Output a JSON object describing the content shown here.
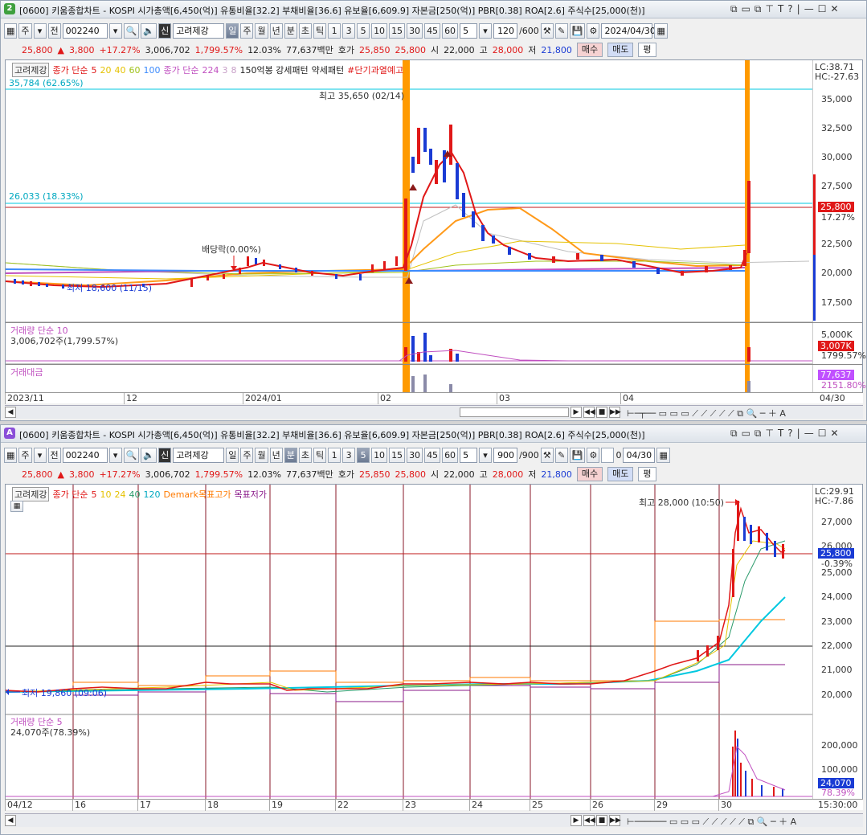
{
  "colors": {
    "up": "#e01818",
    "down": "#1a3bd4",
    "ma5": "#e01818",
    "ma20": "#ff9a1a",
    "ma60": "#9fc21a",
    "ma120": "#3d8bfd",
    "cyan": "#00c8e0",
    "magenta": "#c050c0",
    "orange": "#ff9a00"
  },
  "top": {
    "badge": "2",
    "title": "[0600] 키움종합차트 - KOSPI 시가총액[6,450(억)] 유통비율[32.2] 부채비율[36.6] 유보율[6,609.9] 자본금[250(억)] PBR[0.38] ROA[2.6] 주식수[25,000(천)]",
    "toolbar": {
      "mode1": "주",
      "mode2": "전",
      "code": "002240",
      "sin": "신",
      "adj": "고려제강",
      "periods": [
        "일",
        "주",
        "월",
        "년",
        "분",
        "초",
        "틱"
      ],
      "active_period": "일",
      "nums": [
        "1",
        "3",
        "5",
        "10",
        "15",
        "30",
        "45",
        "60"
      ],
      "sel": "5",
      "count": "120",
      "count_total": "/600",
      "date": "2024/04/30"
    },
    "quote": {
      "price": "25,800",
      "arrow": "▲",
      "chg": "3,800",
      "pct": "+17.27%",
      "vol": "3,006,702",
      "volpct": "1,799.57%",
      "turnover": "12.03%",
      "amount": "77,637백만",
      "hoga_label": "호가",
      "hoga1": "25,850",
      "hoga2": "25,800",
      "open_label": "시",
      "open": "22,000",
      "high_label": "고",
      "high": "28,000",
      "low_label": "저",
      "low": "21,800",
      "buy": "매수",
      "sell": "매도",
      "avg": "평"
    },
    "legend": {
      "adj": "고려제강",
      "ma_label": "종가 단순",
      "ma": [
        "5",
        "20",
        "40",
        "60",
        "100"
      ],
      "ma2_label": "종가 단순",
      "ma2": [
        "224",
        "3",
        "8"
      ],
      "pattern": "150억봉 강세패턴",
      "weak": "약세패턴",
      "warn": "#단기과열예고"
    },
    "annotations": {
      "line1": "35,784 (62.65%)",
      "line2": "26,033 (18.33%)",
      "high": "최고 35,650 (02/14)",
      "low": "최저 18,600 (11/15)",
      "div": "배당락(0.00%)"
    },
    "lc": "LC:38.71",
    "hc": "HC:-27.63",
    "yticks": [
      "35,000",
      "32,500",
      "30,000",
      "27,500",
      "25,000",
      "22,500",
      "20,000",
      "17,500"
    ],
    "price_tag": "25,800",
    "price_pct": "17.27%",
    "vol_panel": {
      "label": "거래량 단순 10",
      "value": "3,006,702주(1,799.57%)",
      "tick": "5,000K",
      "tag": "3,007K",
      "pct": "1799.57%"
    },
    "amt_panel": {
      "label": "거래대금",
      "tag": "77,637",
      "pct": "2151.80%"
    },
    "xticks": [
      "2023/11",
      "12",
      "2024/01",
      "02",
      "03",
      "04"
    ],
    "xend": "04/30"
  },
  "bottom": {
    "badge": "A",
    "title": "[0600] 키움종합차트 - KOSPI 시가총액[6,450(억)] 유통비율[32.2] 부채비율[36.6] 유보율[6,609.9] 자본금[250(억)] PBR[0.38] ROA[2.6] 주식수[25,000(천)]",
    "toolbar": {
      "mode1": "주",
      "mode2": "전",
      "code": "002240",
      "sin": "신",
      "adj": "고려제강",
      "periods": [
        "일",
        "주",
        "월",
        "년",
        "분",
        "초",
        "틱"
      ],
      "active_period": "분",
      "nums": [
        "1",
        "3",
        "5",
        "10",
        "15",
        "30",
        "45",
        "60"
      ],
      "active_num": "5",
      "sel": "5",
      "count": "900",
      "count_total": "/900",
      "zero": "0",
      "date": "04/30"
    },
    "quote": {
      "price": "25,800",
      "arrow": "▲",
      "chg": "3,800",
      "pct": "+17.27%",
      "vol": "3,006,702",
      "volpct": "1,799.57%",
      "turnover": "12.03%",
      "amount": "77,637백만",
      "hoga_label": "호가",
      "hoga1": "25,850",
      "hoga2": "25,800",
      "open_label": "시",
      "open": "22,000",
      "high_label": "고",
      "high": "28,000",
      "low_label": "저",
      "low": "21,800",
      "buy": "매수",
      "sell": "매도",
      "avg": "평"
    },
    "legend": {
      "adj": "고려제강",
      "ma_label": "종가 단순",
      "ma": [
        "5",
        "10",
        "24",
        "40",
        "120"
      ],
      "demark": "Demark목표고가",
      "demark_low": "목표저가"
    },
    "annotations": {
      "high": "최고 28,000 (10:50)",
      "low": "최저 19,860 (09:06)"
    },
    "lc": "LC:29.91",
    "hc": "HC:-7.86",
    "yticks": [
      "27,000",
      "26,000",
      "25,000",
      "24,000",
      "23,000",
      "22,000",
      "21,000",
      "20,000"
    ],
    "price_tag": "25,800",
    "price_pct": "-0.39%",
    "vol_panel": {
      "label": "거래량 단순 5",
      "value": "24,070주(78.39%)",
      "ticks": [
        "200,000",
        "100,000"
      ],
      "tag": "24,070",
      "pct": "78.39%"
    },
    "xticks": [
      "04/12",
      "16",
      "17",
      "18",
      "19",
      "22",
      "23",
      "24",
      "25",
      "26",
      "29",
      "30"
    ],
    "xend": "15:30:00"
  }
}
